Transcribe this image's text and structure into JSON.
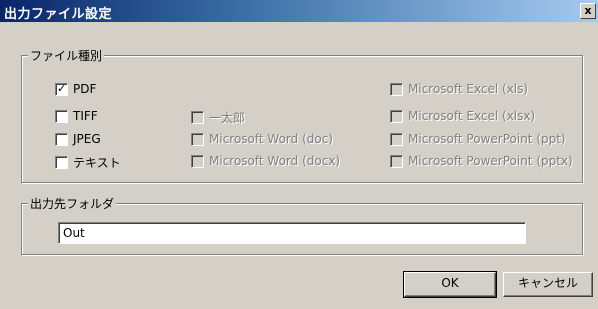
{
  "window": {
    "title": "出力ファイル設定",
    "close_glyph": "x"
  },
  "file_type_group": {
    "label": "ファイル種別",
    "options": [
      {
        "label": "PDF",
        "checked": true,
        "enabled": true
      },
      {
        "label": "TIFF",
        "checked": false,
        "enabled": true
      },
      {
        "label": "JPEG",
        "checked": false,
        "enabled": true
      },
      {
        "label": "テキスト",
        "checked": false,
        "enabled": true
      },
      {
        "label": "一太郎",
        "checked": false,
        "enabled": false
      },
      {
        "label": "Microsoft Word (doc)",
        "checked": false,
        "enabled": false
      },
      {
        "label": "Microsoft Word (docx)",
        "checked": false,
        "enabled": false
      },
      {
        "label": "Microsoft Excel (xls)",
        "checked": false,
        "enabled": false
      },
      {
        "label": "Microsoft Excel (xlsx)",
        "checked": false,
        "enabled": false
      },
      {
        "label": "Microsoft PowerPoint (ppt)",
        "checked": false,
        "enabled": false
      },
      {
        "label": "Microsoft PowerPoint (pptx)",
        "checked": false,
        "enabled": false
      }
    ]
  },
  "output_folder_group": {
    "label": "出力先フォルダ",
    "value": "Out"
  },
  "buttons": {
    "ok": "OK",
    "cancel": "キャンセル"
  }
}
